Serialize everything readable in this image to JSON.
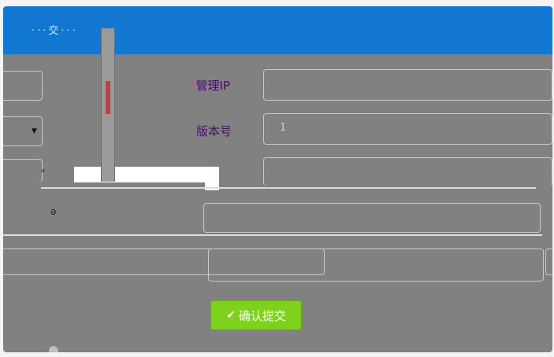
{
  "dialog": {
    "title": "···交···",
    "submit_label": "确认提交",
    "submit_icon": "checkmark-icon"
  },
  "form": {
    "manage_ip_label": "管理IP",
    "version_label": "版本号",
    "version_value": "1",
    "obscured_label": "ᵃ",
    "fragment_label": "ǝ"
  },
  "colors": {
    "header": "#1177d1",
    "dialog_bg": "#818181",
    "submit": "#7ed21e",
    "label": "#4b0c6d",
    "required": "#d14c8c"
  }
}
